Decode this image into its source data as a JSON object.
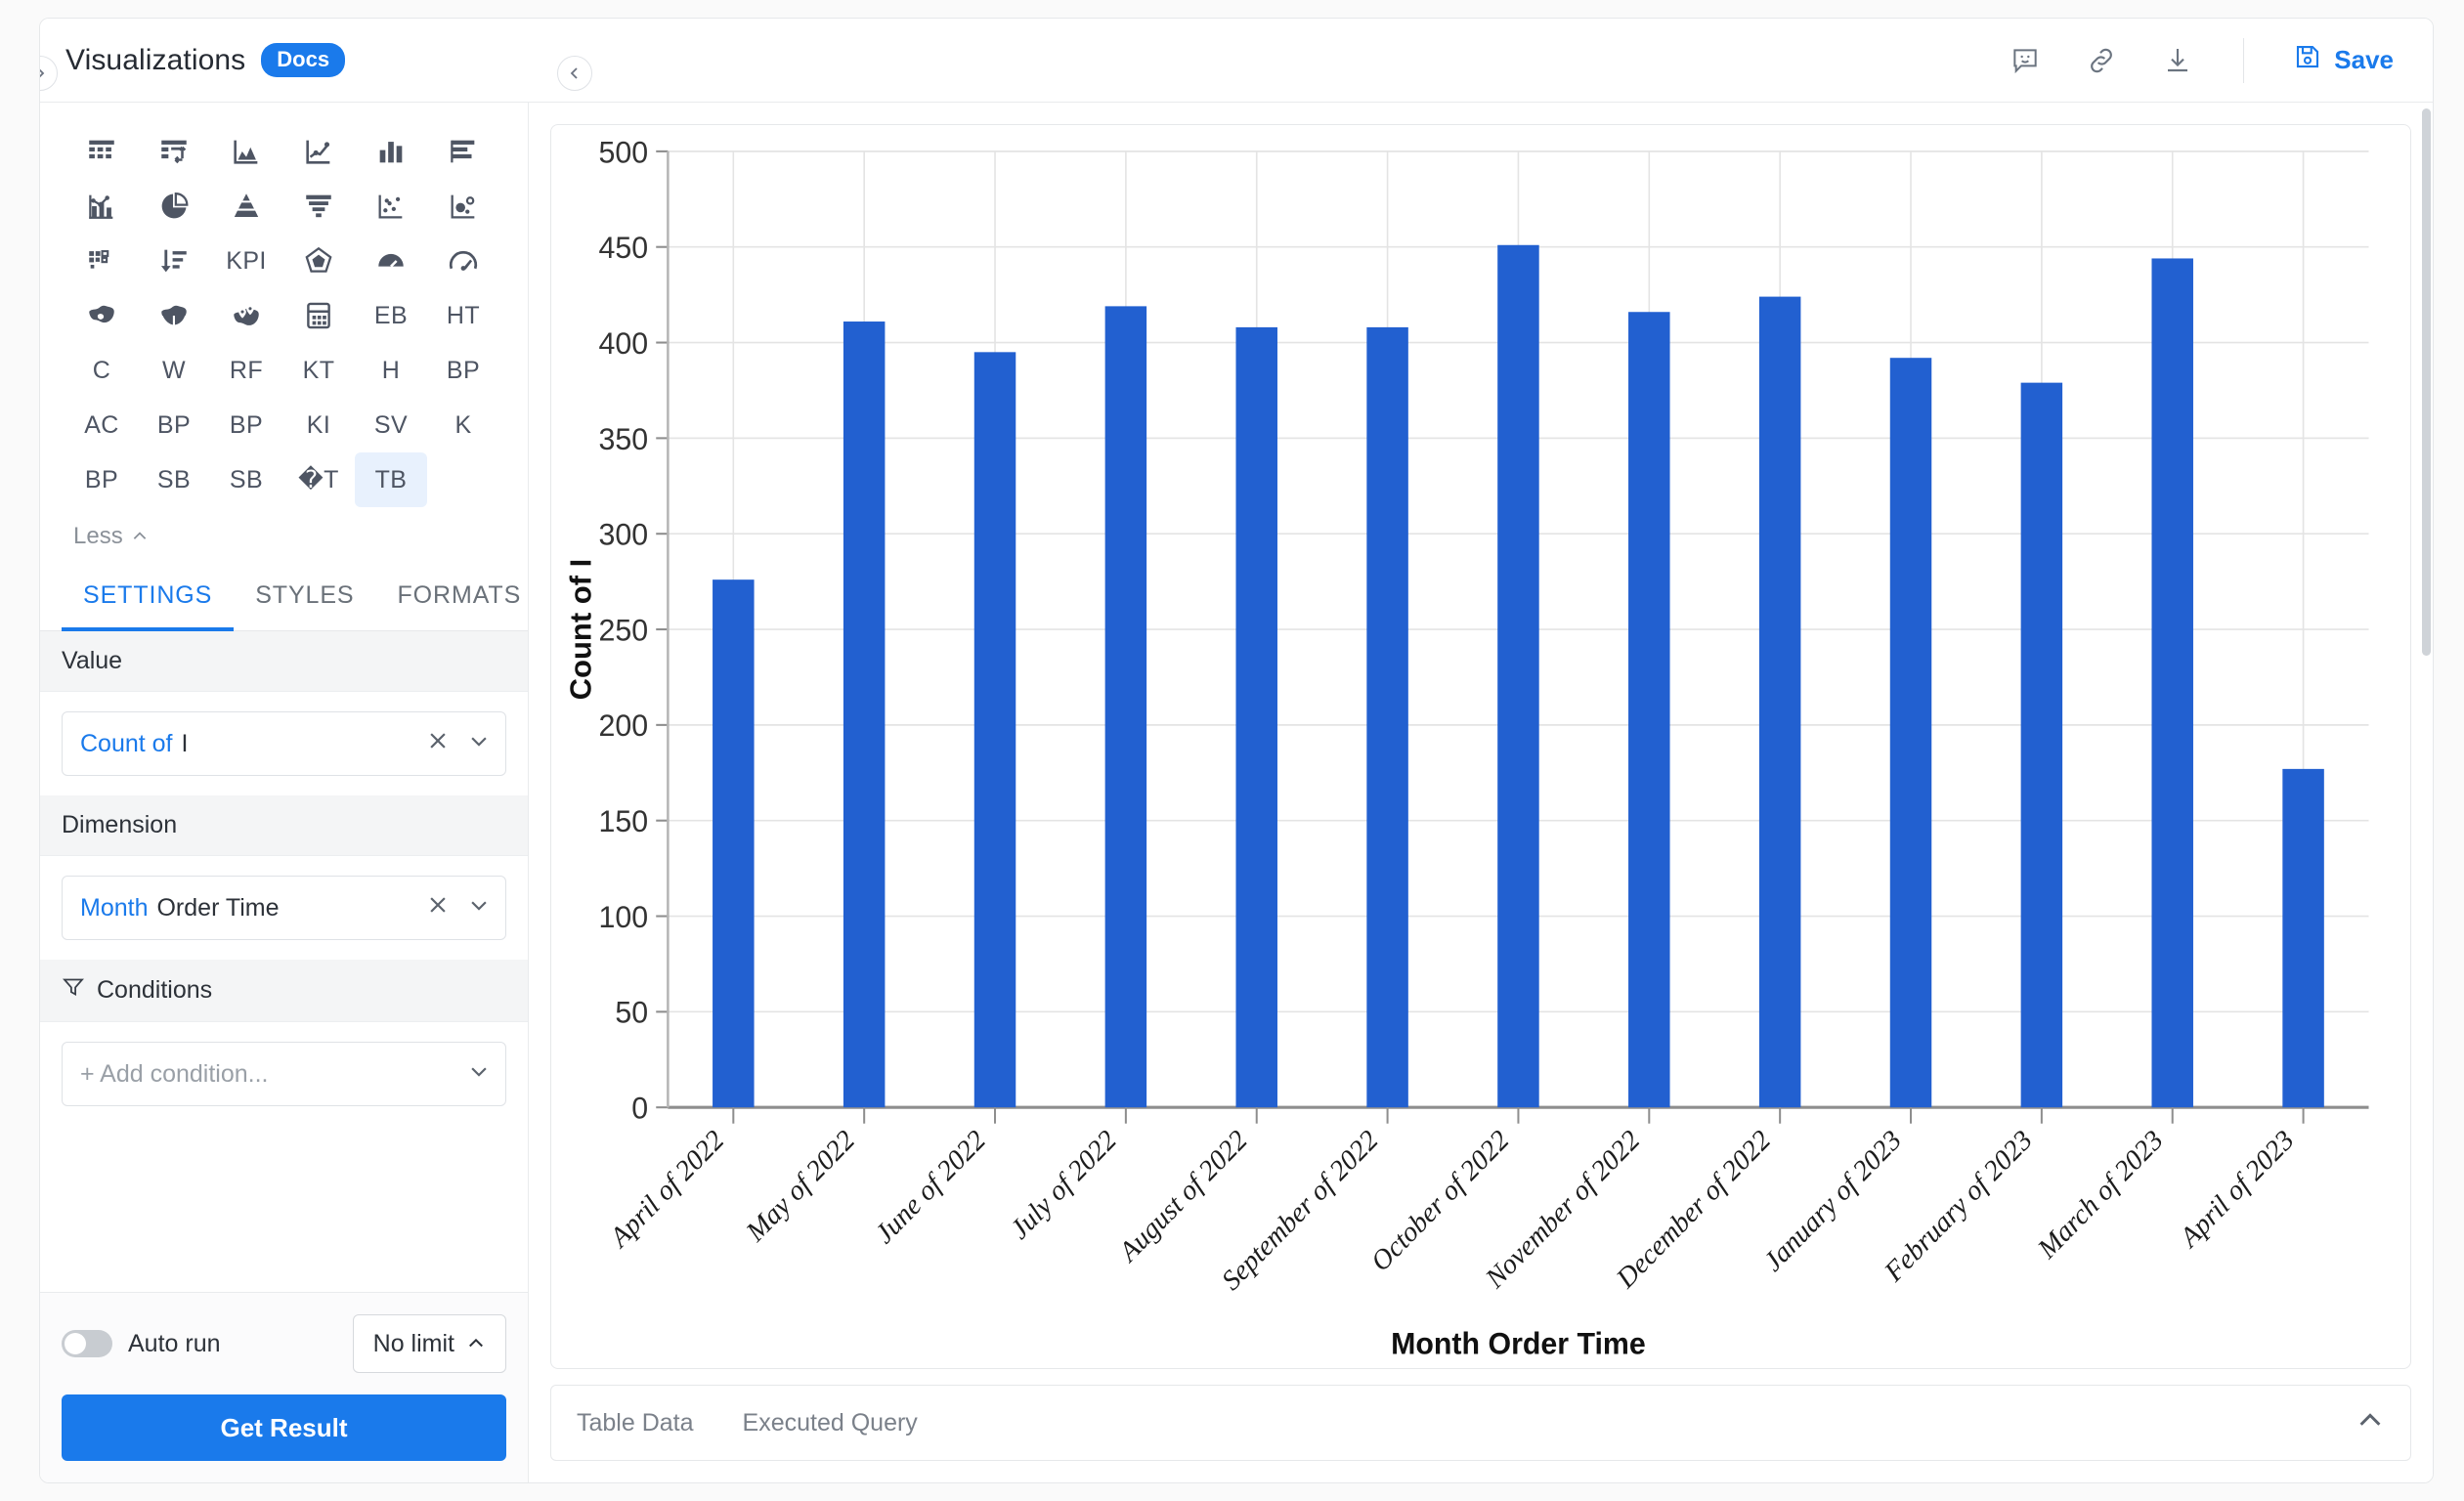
{
  "header": {
    "title": "Visualizations",
    "docs_badge": "Docs",
    "expand_icon": "chevron-right-icon",
    "collapse_icon": "chevron-left-icon",
    "comment_icon": "comment-smiley-icon",
    "link_icon": "link-icon",
    "download_icon": "download-icon",
    "save_label": "Save",
    "save_icon": "save-disk-icon",
    "accent_color": "#1a7aeb"
  },
  "palette": {
    "less_label": "Less",
    "selected": "TB",
    "rows": [
      [
        {
          "name": "table-icon",
          "type": "icon",
          "glyph": "table"
        },
        {
          "name": "pivot-table-icon",
          "type": "icon",
          "glyph": "pivot"
        },
        {
          "name": "area-chart-icon",
          "type": "icon",
          "glyph": "area"
        },
        {
          "name": "line-chart-icon",
          "type": "icon",
          "glyph": "line"
        },
        {
          "name": "column-chart-icon",
          "type": "icon",
          "glyph": "column"
        },
        {
          "name": "bar-chart-icon",
          "type": "icon",
          "glyph": "barh"
        }
      ],
      [
        {
          "name": "combo-chart-icon",
          "type": "icon",
          "glyph": "combo"
        },
        {
          "name": "pie-chart-icon",
          "type": "icon",
          "glyph": "pie"
        },
        {
          "name": "pyramid-chart-icon",
          "type": "icon",
          "glyph": "pyramid"
        },
        {
          "name": "funnel-chart-icon",
          "type": "icon",
          "glyph": "funnel"
        },
        {
          "name": "scatter-chart-icon",
          "type": "icon",
          "glyph": "scatter"
        },
        {
          "name": "bubble-chart-icon",
          "type": "icon",
          "glyph": "bubble"
        }
      ],
      [
        {
          "name": "treemap-icon",
          "type": "icon",
          "glyph": "treemap"
        },
        {
          "name": "sorted-bar-icon",
          "type": "icon",
          "glyph": "sortbar"
        },
        {
          "name": "kpi-icon",
          "type": "text",
          "glyph": "KPI"
        },
        {
          "name": "radar-chart-icon",
          "type": "icon",
          "glyph": "radar"
        },
        {
          "name": "gauge-chart-icon",
          "type": "icon",
          "glyph": "gaugefill"
        },
        {
          "name": "speedometer-icon",
          "type": "icon",
          "glyph": "gauge"
        }
      ],
      [
        {
          "name": "map-icon",
          "type": "icon",
          "glyph": "map"
        },
        {
          "name": "region-map-icon",
          "type": "icon",
          "glyph": "regionmap"
        },
        {
          "name": "pin-map-icon",
          "type": "icon",
          "glyph": "pinmap"
        },
        {
          "name": "calculator-icon",
          "type": "icon",
          "glyph": "calc"
        },
        {
          "name": "eb-chart-icon",
          "type": "text",
          "glyph": "EB"
        },
        {
          "name": "ht-chart-icon",
          "type": "text",
          "glyph": "HT"
        }
      ],
      [
        {
          "name": "c-chart-icon",
          "type": "text",
          "glyph": "C"
        },
        {
          "name": "w-chart-icon",
          "type": "text",
          "glyph": "W"
        },
        {
          "name": "rf-chart-icon",
          "type": "text",
          "glyph": "RF"
        },
        {
          "name": "kt-chart-icon",
          "type": "text",
          "glyph": "KT"
        },
        {
          "name": "h-chart-icon",
          "type": "text",
          "glyph": "H"
        },
        {
          "name": "bp-chart-icon",
          "type": "text",
          "glyph": "BP"
        }
      ],
      [
        {
          "name": "ac-chart-icon",
          "type": "text",
          "glyph": "AC"
        },
        {
          "name": "bp2-chart-icon",
          "type": "text",
          "glyph": "BP"
        },
        {
          "name": "bp3-chart-icon",
          "type": "text",
          "glyph": "BP"
        },
        {
          "name": "ki-chart-icon",
          "type": "text",
          "glyph": "KI"
        },
        {
          "name": "sv-chart-icon",
          "type": "text",
          "glyph": "SV"
        },
        {
          "name": "k-chart-icon",
          "type": "text",
          "glyph": "K"
        }
      ],
      [
        {
          "name": "bp4-chart-icon",
          "type": "text",
          "glyph": "BP"
        },
        {
          "name": "sb-chart-icon",
          "type": "text",
          "glyph": "SB"
        },
        {
          "name": "sb2-chart-icon",
          "type": "text",
          "glyph": "SB"
        },
        {
          "name": "unknown-t-chart-icon",
          "type": "text",
          "glyph": "�T"
        },
        {
          "name": "tb-chart-icon",
          "type": "text",
          "glyph": "TB"
        },
        {
          "name": "empty-slot",
          "type": "empty",
          "glyph": ""
        }
      ]
    ]
  },
  "tabs": [
    {
      "label": "SETTINGS",
      "active": true
    },
    {
      "label": "STYLES",
      "active": false
    },
    {
      "label": "FORMATS",
      "active": false
    }
  ],
  "settings": {
    "value_section": "Value",
    "value_field": {
      "accent": "Count of",
      "rest": "I",
      "clear_icon": "close-icon",
      "chevron_icon": "chevron-down-icon"
    },
    "dimension_section": "Dimension",
    "dimension_field": {
      "accent": "Month",
      "rest": "Order Time",
      "clear_icon": "close-icon",
      "chevron_icon": "chevron-down-icon"
    },
    "conditions_section": "Conditions",
    "conditions_icon": "filter-funnel-icon",
    "add_condition_placeholder": "+ Add condition...",
    "add_condition_chevron": "chevron-down-icon"
  },
  "footer": {
    "auto_run_label": "Auto run",
    "auto_run_on": false,
    "limit_label": "No limit",
    "limit_chevron": "chevron-up-icon",
    "get_result_label": "Get Result"
  },
  "bottom_panel": {
    "tabs": [
      "Table Data",
      "Executed Query"
    ],
    "collapse_icon": "chevron-up-icon"
  },
  "chart_data": {
    "type": "bar",
    "title": "",
    "xlabel": "Month Order Time",
    "ylabel": "Count of I",
    "ylim": [
      0,
      500
    ],
    "yticks": [
      0,
      50,
      100,
      150,
      200,
      250,
      300,
      350,
      400,
      450,
      500
    ],
    "grid": true,
    "legend": "none",
    "bar_color": "#2260d0",
    "categories": [
      "April of 2022",
      "May of 2022",
      "June of 2022",
      "July of 2022",
      "August of 2022",
      "September of 2022",
      "October of 2022",
      "November of 2022",
      "December of 2022",
      "January of 2023",
      "February of 2023",
      "March of 2023",
      "April of 2023"
    ],
    "values": [
      276,
      411,
      395,
      419,
      408,
      408,
      451,
      416,
      424,
      392,
      379,
      444,
      177
    ]
  }
}
